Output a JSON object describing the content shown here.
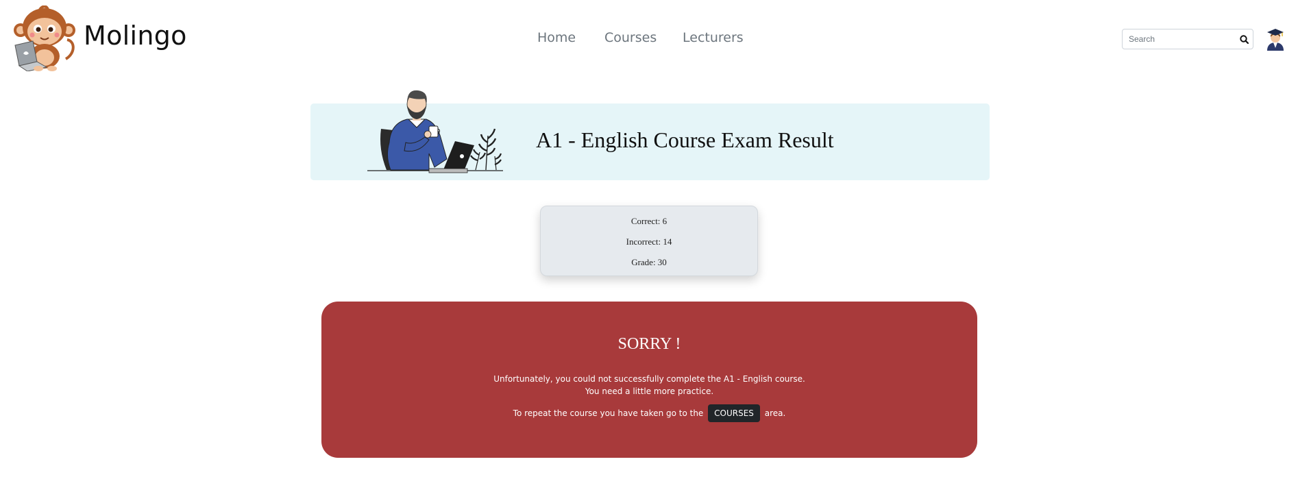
{
  "brand": {
    "name": "Molingo",
    "logo_icon": "monkey-laptop-logo"
  },
  "nav": {
    "items": [
      {
        "label": "Home"
      },
      {
        "label": "Courses"
      },
      {
        "label": "Lecturers"
      }
    ]
  },
  "search": {
    "placeholder": "Search",
    "value": "",
    "icon": "search-icon"
  },
  "user": {
    "avatar_icon": "graduate-avatar-icon"
  },
  "banner": {
    "title": "A1 - English Course Exam Result",
    "illustration": "man-at-laptop-illustration",
    "background": "#e5f5f8"
  },
  "result": {
    "correct": "Correct: 6",
    "incorrect": "Incorrect: 14",
    "grade": "Grade: 30"
  },
  "sorry": {
    "title": "SORRY !",
    "line1": "Unfortunately, you could not successfully complete the A1 - English course.",
    "line2": "You need a little more practice.",
    "repeat_prefix": "To repeat the course you have taken go to the",
    "courses_button": "COURSES",
    "repeat_suffix": "area.",
    "background": "#a83a3b"
  }
}
